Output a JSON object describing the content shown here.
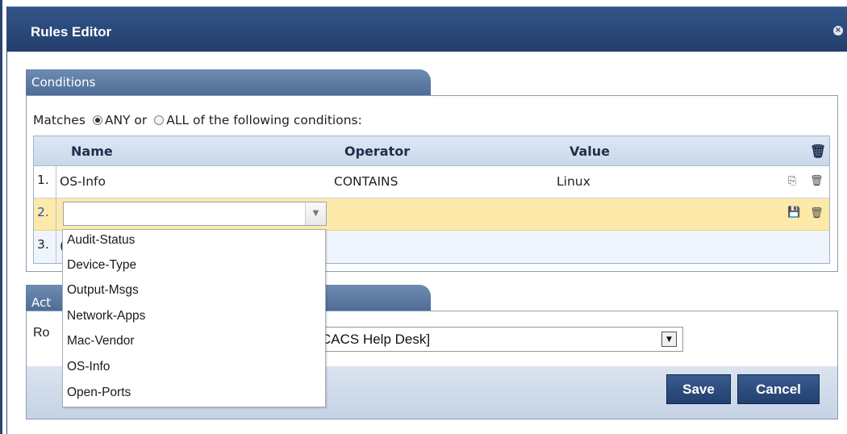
{
  "dialog": {
    "title": "Rules Editor",
    "close_symbol": "×"
  },
  "conditions": {
    "tab_label": "Conditions",
    "matches_prefix": "Matches",
    "any_label": "ANY or",
    "all_label": "ALL of the following conditions:",
    "match_mode": "ANY",
    "columns": {
      "name": "Name",
      "operator": "Operator",
      "value": "Value"
    },
    "rows": [
      {
        "num": "1.",
        "name": "OS-Info",
        "operator": "CONTAINS",
        "value": "Linux"
      },
      {
        "num": "2.",
        "name": "",
        "operator": "",
        "value": ""
      },
      {
        "num": "3.",
        "name_partial": "(",
        "name": "",
        "operator": "",
        "value": ""
      }
    ]
  },
  "name_dropdown": {
    "options": [
      "Audit-Status",
      "Device-Type",
      "Output-Msgs",
      "Network-Apps",
      "Mac-Vendor",
      "OS-Info",
      "Open-Ports"
    ]
  },
  "actions": {
    "tab_label_partial": "Act",
    "role_label_partial": "Ro",
    "role_value_partial": "CACS Help Desk]"
  },
  "footer": {
    "save_label": "Save",
    "cancel_label": "Cancel"
  },
  "icons": {
    "copy": "copy-icon",
    "delete": "trash-icon",
    "save": "floppy-icon"
  },
  "colors": {
    "title_bar": "#2b4a7a",
    "editing_row": "#fde9a8",
    "button": "#2c4a7c"
  }
}
